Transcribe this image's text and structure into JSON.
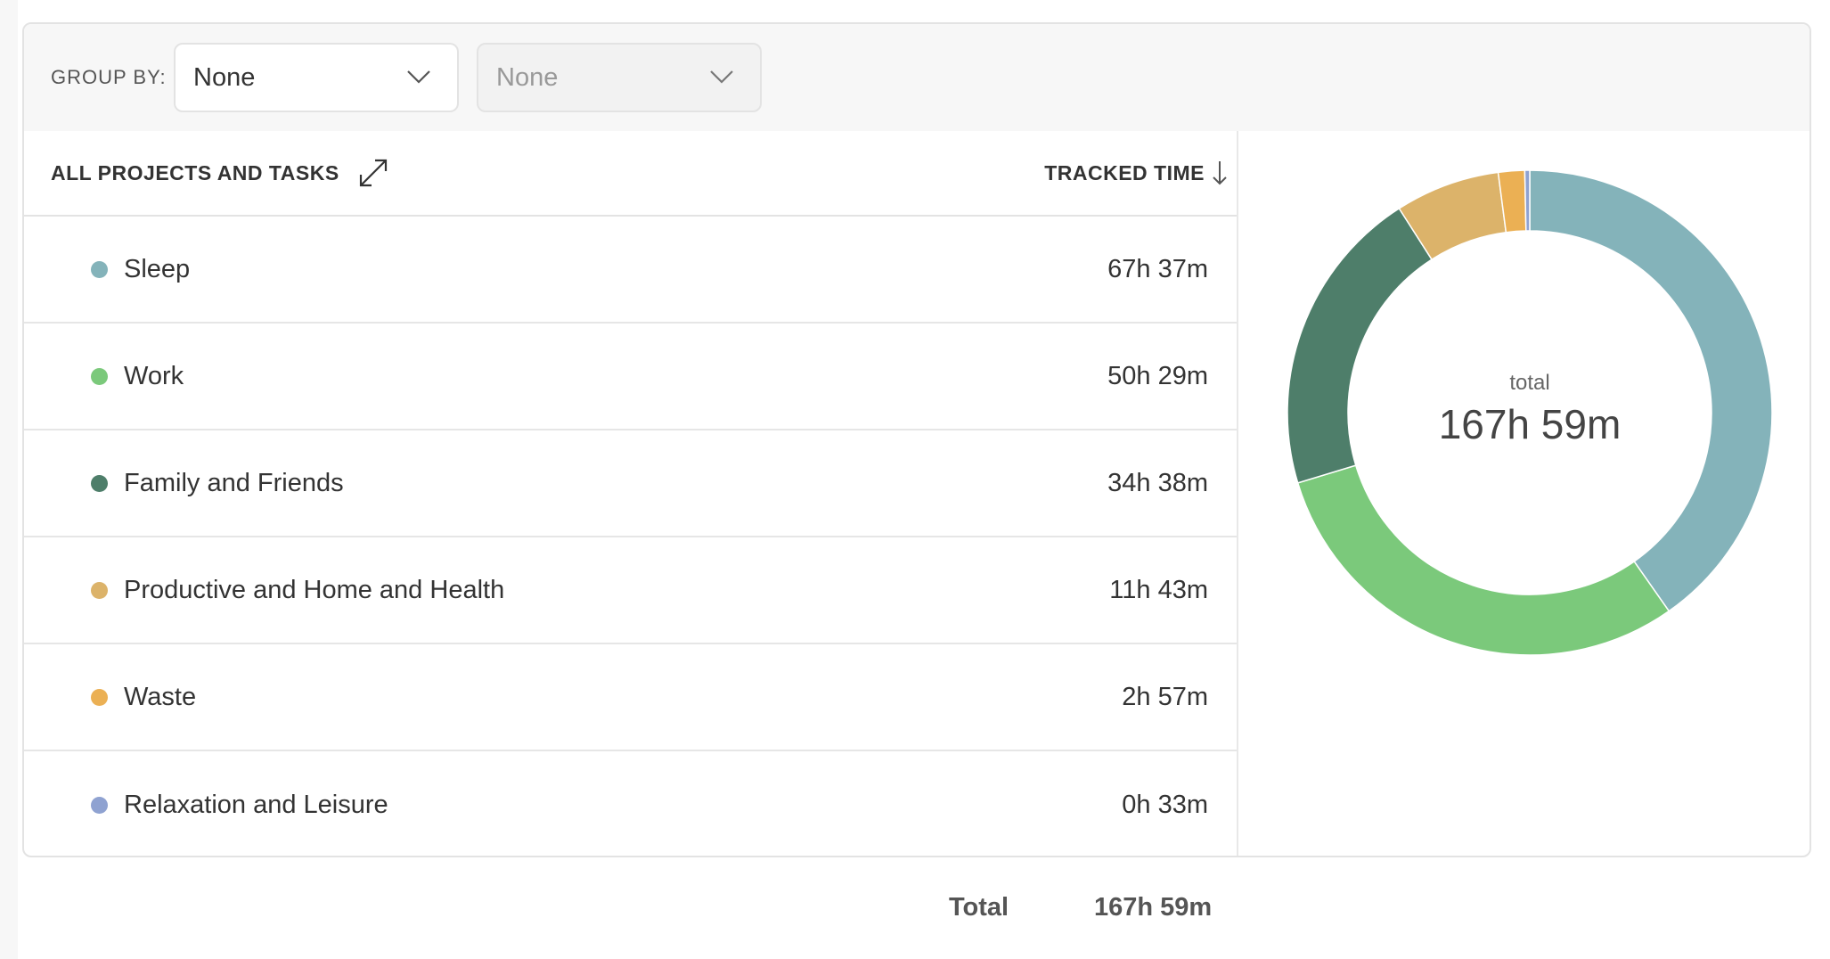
{
  "toolbar": {
    "group_by_label": "GROUP BY:",
    "group_select_value": "None",
    "subgroup_select_value": "None"
  },
  "list": {
    "header_left": "ALL PROJECTS AND TASKS",
    "header_right": "TRACKED TIME",
    "rows": [
      {
        "name": "Sleep",
        "time": "67h 37m",
        "color": "#84b3ba"
      },
      {
        "name": "Work",
        "time": "50h 29m",
        "color": "#7bc97b"
      },
      {
        "name": "Family and Friends",
        "time": "34h 38m",
        "color": "#4e7e6a"
      },
      {
        "name": "Productive and Home and Health",
        "time": "11h 43m",
        "color": "#dcb36a"
      },
      {
        "name": "Waste",
        "time": "2h 57m",
        "color": "#ebb054"
      },
      {
        "name": "Relaxation and Leisure",
        "time": "0h 33m",
        "color": "#8fa2d1"
      }
    ]
  },
  "chart_data": {
    "type": "pie",
    "categories": [
      "Sleep",
      "Work",
      "Family and Friends",
      "Productive and Home and Health",
      "Waste",
      "Relaxation and Leisure"
    ],
    "values": [
      67.617,
      50.483,
      34.633,
      11.717,
      2.95,
      0.55
    ],
    "colors": [
      "#84b3ba",
      "#7bc97b",
      "#4e7e6a",
      "#dcb36a",
      "#ebb054",
      "#8fa2d1"
    ],
    "center_label": "total",
    "center_value": "167h 59m"
  },
  "footer": {
    "total_label": "Total",
    "total_value": "167h 59m"
  }
}
